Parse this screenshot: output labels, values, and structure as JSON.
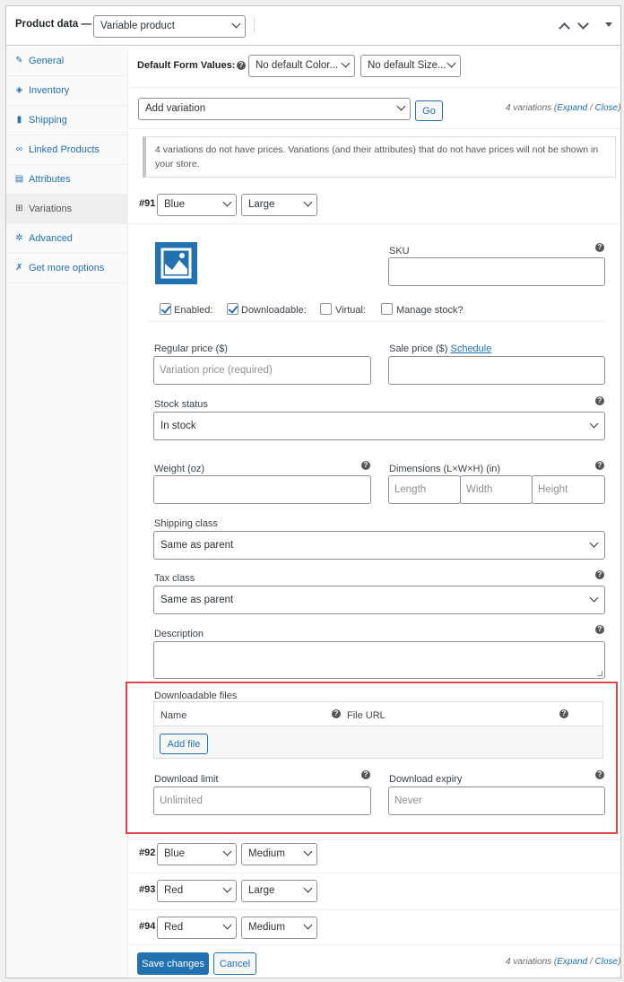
{
  "header": {
    "title": "Product data —",
    "product_type": "Variable product"
  },
  "sidebar": {
    "items": [
      {
        "label": "General",
        "icon": "wrench-icon"
      },
      {
        "label": "Inventory",
        "icon": "tag-icon"
      },
      {
        "label": "Shipping",
        "icon": "truck-icon"
      },
      {
        "label": "Linked Products",
        "icon": "link-icon"
      },
      {
        "label": "Attributes",
        "icon": "list-icon"
      },
      {
        "label": "Variations",
        "icon": "grid-icon"
      },
      {
        "label": "Advanced",
        "icon": "gear-icon"
      },
      {
        "label": "Get more options",
        "icon": "plugin-icon"
      }
    ]
  },
  "defaults": {
    "label": "Default Form Values:",
    "color": "No default Color...",
    "size": "No default Size..."
  },
  "toolbar": {
    "action": "Add variation",
    "go": "Go",
    "count": "4 variations (",
    "expand": "Expand",
    "slash": " / ",
    "close": "Close",
    "paren": ")"
  },
  "notice": "4 variations do not have prices. Variations (and their attributes) that do not have prices will not be shown in your store.",
  "variation91": {
    "num": "#91",
    "color": "Blue",
    "size": "Large",
    "sku_label": "SKU",
    "enabled": "Enabled:",
    "downloadable": "Downloadable:",
    "virtual": "Virtual:",
    "manage_stock": "Manage stock?",
    "regular_price_label": "Regular price ($)",
    "regular_price_placeholder": "Variation price (required)",
    "sale_price_label": "Sale price ($)",
    "schedule": "Schedule",
    "stock_status_label": "Stock status",
    "stock_status": "In stock",
    "weight_label": "Weight (oz)",
    "dimensions_label": "Dimensions (L×W×H) (in)",
    "length": "Length",
    "width": "Width",
    "height": "Height",
    "shipping_class_label": "Shipping class",
    "shipping_class": "Same as parent",
    "tax_class_label": "Tax class",
    "tax_class": "Same as parent",
    "description_label": "Description",
    "downloadable_files_label": "Downloadable files",
    "col_name": "Name",
    "col_url": "File URL",
    "add_file": "Add file",
    "download_limit_label": "Download limit",
    "download_limit": "Unlimited",
    "download_expiry_label": "Download expiry",
    "download_expiry": "Never"
  },
  "variations": [
    {
      "num": "#92",
      "color": "Blue",
      "size": "Medium"
    },
    {
      "num": "#93",
      "color": "Red",
      "size": "Large"
    },
    {
      "num": "#94",
      "color": "Red",
      "size": "Medium"
    }
  ],
  "footer": {
    "save": "Save changes",
    "cancel": "Cancel"
  },
  "help_glyph": "?"
}
